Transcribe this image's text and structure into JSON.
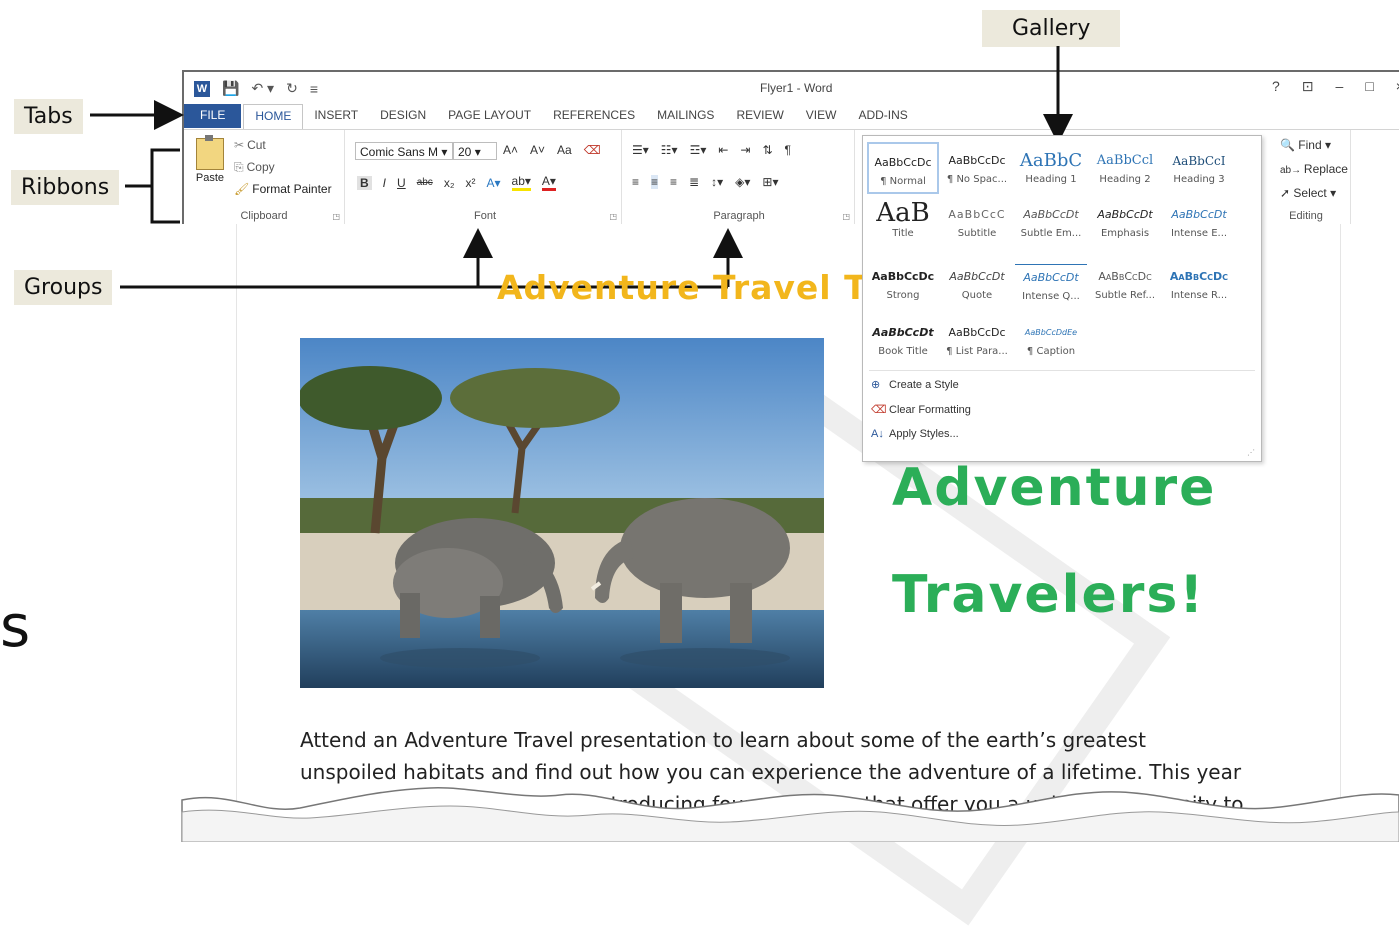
{
  "callouts": {
    "tabs": "Tabs",
    "ribbons": "Ribbons",
    "groups": "Groups",
    "gallery": "Gallery",
    "stray_letter": "s"
  },
  "titlebar": {
    "document_title": "Flyer1 - Word",
    "help": "?",
    "restore": "⊡",
    "minimize": "–",
    "maximize": "□",
    "close": "×"
  },
  "tabs": [
    "FILE",
    "HOME",
    "INSERT",
    "DESIGN",
    "PAGE LAYOUT",
    "REFERENCES",
    "MAILINGS",
    "REVIEW",
    "VIEW",
    "ADD-INS"
  ],
  "ribbon": {
    "clipboard": {
      "paste": "Paste",
      "cut": "Cut",
      "copy": "Copy",
      "format_painter": "Format Painter",
      "label": "Clipboard"
    },
    "font": {
      "font_name": "Comic Sans M",
      "font_size": "20",
      "bold": "B",
      "italic": "I",
      "underline": "U",
      "strike": "abc",
      "subscript": "x₂",
      "superscript": "x²",
      "grow": "A˄",
      "shrink": "A˅",
      "change_case": "Aa",
      "label": "Font"
    },
    "paragraph": {
      "label": "Paragraph"
    },
    "editing": {
      "find": "Find",
      "replace": "Replace",
      "select": "Select",
      "label": "Editing"
    }
  },
  "gallery": {
    "styles": [
      {
        "sample": "AaBbCcDc",
        "name": "¶ Normal"
      },
      {
        "sample": "AaBbCcDc",
        "name": "¶ No Spac..."
      },
      {
        "sample": "AaBbC",
        "name": "Heading 1"
      },
      {
        "sample": "AaBbCcl",
        "name": "Heading 2"
      },
      {
        "sample": "AaBbCcI",
        "name": "Heading 3"
      },
      {
        "sample": "AaB",
        "name": "Title"
      },
      {
        "sample": "AaBbCcC",
        "name": "Subtitle"
      },
      {
        "sample": "AaBbCcDt",
        "name": "Subtle Em..."
      },
      {
        "sample": "AaBbCcDt",
        "name": "Emphasis"
      },
      {
        "sample": "AaBbCcDt",
        "name": "Intense E..."
      },
      {
        "sample": "AaBbCcDc",
        "name": "Strong"
      },
      {
        "sample": "AaBbCcDt",
        "name": "Quote"
      },
      {
        "sample": "AaBbCcDt",
        "name": "Intense Q..."
      },
      {
        "sample": "AaBbCcDc",
        "name": "Subtle Ref..."
      },
      {
        "sample": "AaBbCcDc",
        "name": "Intense R..."
      },
      {
        "sample": "AaBbCcDt",
        "name": "Book Title"
      },
      {
        "sample": "AaBbCcDc",
        "name": "¶ List Para..."
      },
      {
        "sample": "AaBbCcDdEe",
        "name": "¶ Caption"
      }
    ],
    "commands": [
      "Create a Style",
      "Clear Formatting",
      "Apply Styles..."
    ]
  },
  "document": {
    "heading": "Adventure Travel To",
    "green_line1": "Adventure",
    "green_line2": "Travelers!",
    "body_line1": "Attend an Adventure Travel presentation to learn about some of the earth’s greatest",
    "body_line2": "unspoiled habitats and find out how you can experience the adventure of a lifetime. This year",
    "body_line3": "is introducing four new tours that offer you a unique opportunity to"
  }
}
